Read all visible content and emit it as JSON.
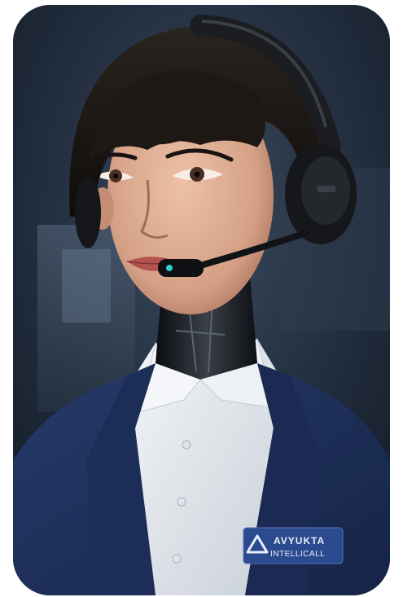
{
  "badge": {
    "brand_line1": "AVYUKTA",
    "brand_line2": "INTELLICALL",
    "logo_icon": "triangle-logo-icon",
    "color": "#2b4a8f"
  },
  "colors": {
    "suit": "#1e2f5a",
    "shirt": "#e7ebef",
    "hair": "#17130f",
    "skin": "#d8a58a",
    "background": "#1b2533",
    "headset": "#15171a"
  }
}
